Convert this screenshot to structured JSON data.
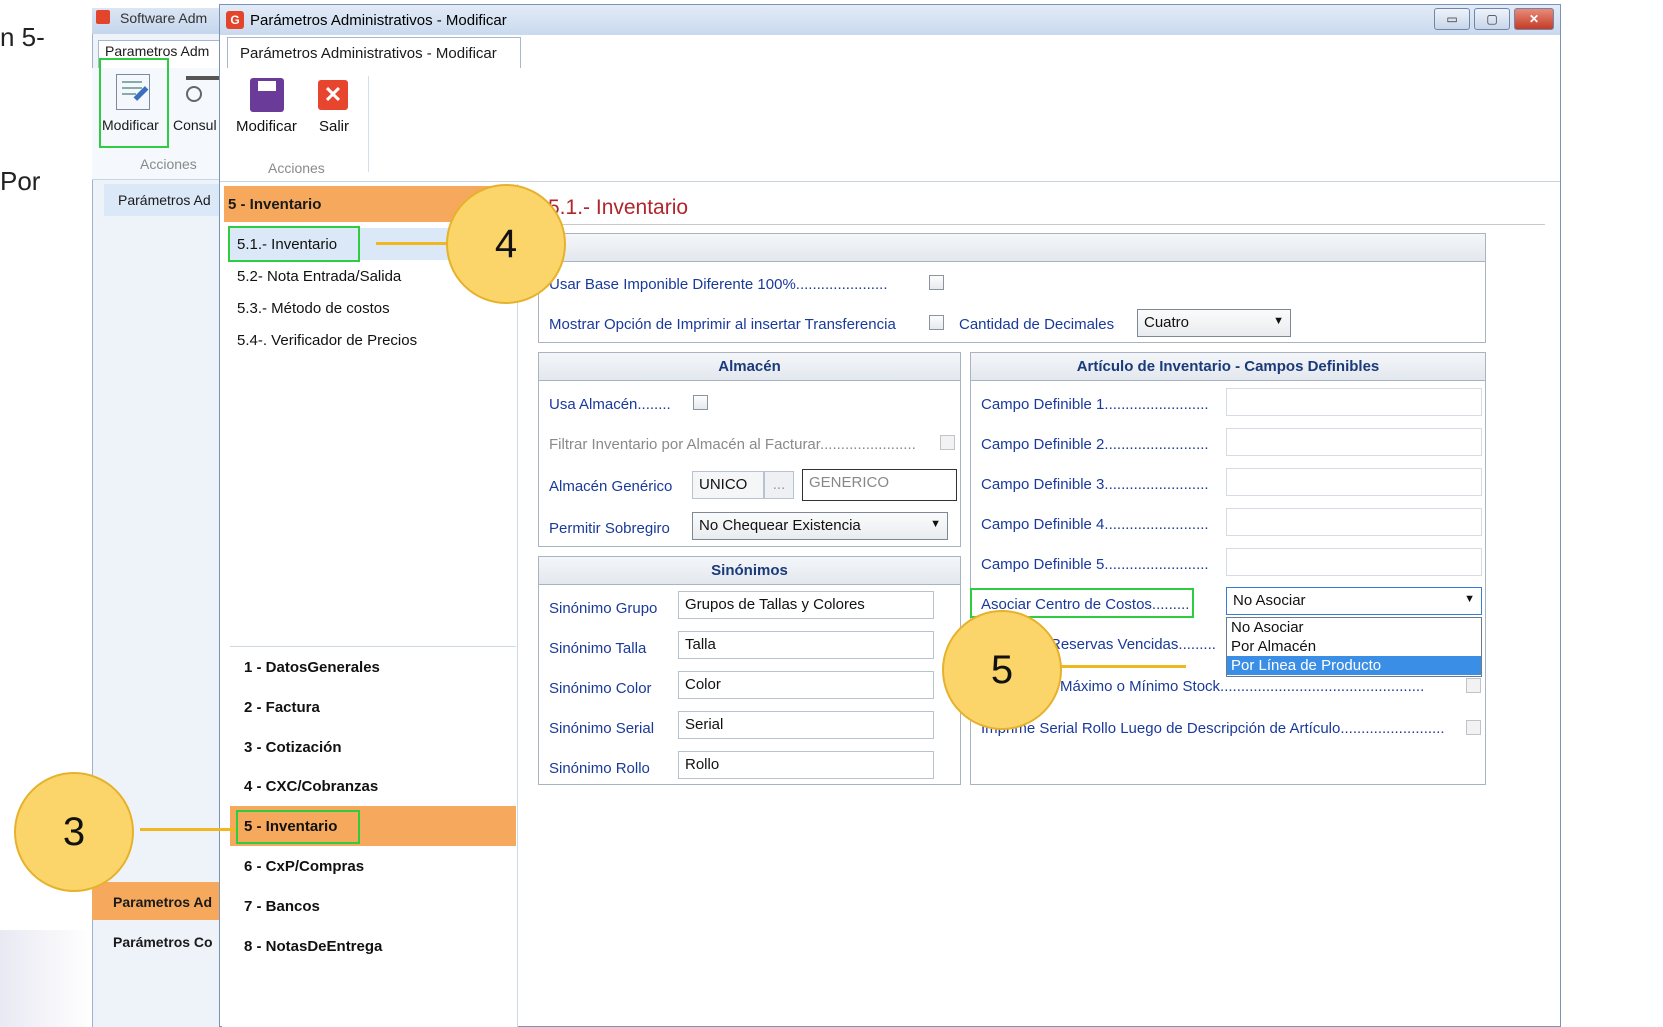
{
  "slide": {
    "frag1": "n 5-",
    "frag2": "Por"
  },
  "background_window": {
    "title": "Software Adm",
    "tab": "Parametros Adm",
    "buttons": [
      "Modificar",
      "Consul"
    ],
    "group_label": "Acciones",
    "nav_item": "Parámetros Ad",
    "bottom_items": [
      "Parametros Ad",
      "Parámetros Co"
    ]
  },
  "window": {
    "title": "Parámetros Administrativos - Modificar",
    "tab": "Parámetros Administrativos - Modificar",
    "controls": [
      "▭",
      "▢",
      "✕"
    ]
  },
  "ribbon": {
    "modify_label": "Modificar",
    "exit_label": "Salir",
    "group_label": "Acciones",
    "exit_glyph": "✕"
  },
  "nav": {
    "header": "5 - Inventario",
    "sub_items": [
      "5.1.- Inventario",
      "5.2- Nota Entrada/Salida",
      "5.3.- Método  de costos",
      "5.4-. Verificador de Precios"
    ],
    "main_items": [
      "1 - DatosGenerales",
      "2 - Factura",
      "3 - Cotización",
      "4 - CXC/Cobranzas",
      "5 - Inventario",
      "6 - CxP/Compras",
      "7 - Bancos",
      "8 - NotasDeEntrega"
    ]
  },
  "content": {
    "section_title": "5.1.- Inventario",
    "general": {
      "base_imponible": "Usar Base Imponible Diferente 100%......................",
      "mostrar_opcion": "Mostrar Opción de Imprimir al insertar Transferencia",
      "cantidad_decimales_label": "Cantidad de Decimales",
      "cantidad_decimales_value": "Cuatro"
    },
    "almacen": {
      "title": "Almacén",
      "usa_almacen": "Usa Almacén........",
      "filtrar": "Filtrar Inventario por Almacén al Facturar.......................",
      "generico_label": "Almacén Genérico",
      "generico_code": "UNICO",
      "generico_btn": "...",
      "generico_name": "GENERICO",
      "sobregiro_label": "Permitir Sobregiro",
      "sobregiro_value": "No Chequear Existencia"
    },
    "sinonimos": {
      "title": "Sinónimos",
      "rows": [
        {
          "label": "Sinónimo Grupo",
          "value": "Grupos de Tallas y Colores"
        },
        {
          "label": "Sinónimo Talla",
          "value": "Talla"
        },
        {
          "label": "Sinónimo Color",
          "value": "Color"
        },
        {
          "label": "Sinónimo Serial",
          "value": "Serial"
        },
        {
          "label": "Sinónimo Rollo",
          "value": "Rollo"
        }
      ]
    },
    "articulo": {
      "title": "Artículo de Inventario - Campos Definibles",
      "campos": [
        "Campo Definible 1.........................",
        "Campo Definible 2.........................",
        "Campo Definible 3.........................",
        "Campo Definible 4.........................",
        "Campo Definible 5........................."
      ],
      "centro_costos_label": "Asociar Centro de Costos.........",
      "centro_costos_value": "No Asociar",
      "reservas": "Reservas Vencidas.........",
      "maximo": "Máximo o Mínimo Stock.................................................",
      "imprime": "Imprime Serial Rollo Luego de Descripción de Artículo........................."
    },
    "dropdown_options": [
      "No Asociar",
      "Por Almacén",
      "Por Línea de Producto"
    ]
  },
  "callouts": [
    "3",
    "4",
    "5"
  ],
  "colors": {
    "accent_orange": "#f6a95c",
    "callout_yellow": "#fbd56a",
    "highlight_green": "#2ecc40",
    "label_blue": "#1a3a9a",
    "title_red": "#b0262a",
    "selection_blue": "#3a8ee6"
  }
}
